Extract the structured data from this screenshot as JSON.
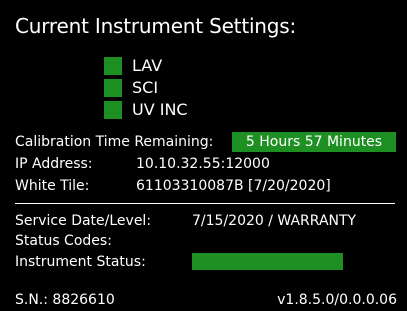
{
  "title": "Current Instrument Settings:",
  "lamps": [
    {
      "label": "LAV",
      "color": "#1e8f22"
    },
    {
      "label": "SCI",
      "color": "#1e8f22"
    },
    {
      "label": "UV INC",
      "color": "#1e8f22"
    }
  ],
  "calibration": {
    "label": "Calibration Time Remaining:",
    "value": "5 Hours 57 Minutes"
  },
  "ip": {
    "label": "IP Address:",
    "value": "10.10.32.55:12000"
  },
  "white_tile": {
    "label": "White Tile:",
    "value": "61103310087B [7/20/2020]"
  },
  "service": {
    "label": "Service Date/Level:",
    "value": "7/15/2020 / WARRANTY"
  },
  "status_codes": {
    "label": "Status Codes:"
  },
  "instrument_status": {
    "label": "Instrument Status:",
    "color": "#1e8f22"
  },
  "footer": {
    "serial": "S.N.: 8826610",
    "version": "v1.8.5.0/0.0.0.06"
  },
  "colors": {
    "background": "#000000",
    "text": "#ffffff",
    "accent": "#1e8f22"
  }
}
